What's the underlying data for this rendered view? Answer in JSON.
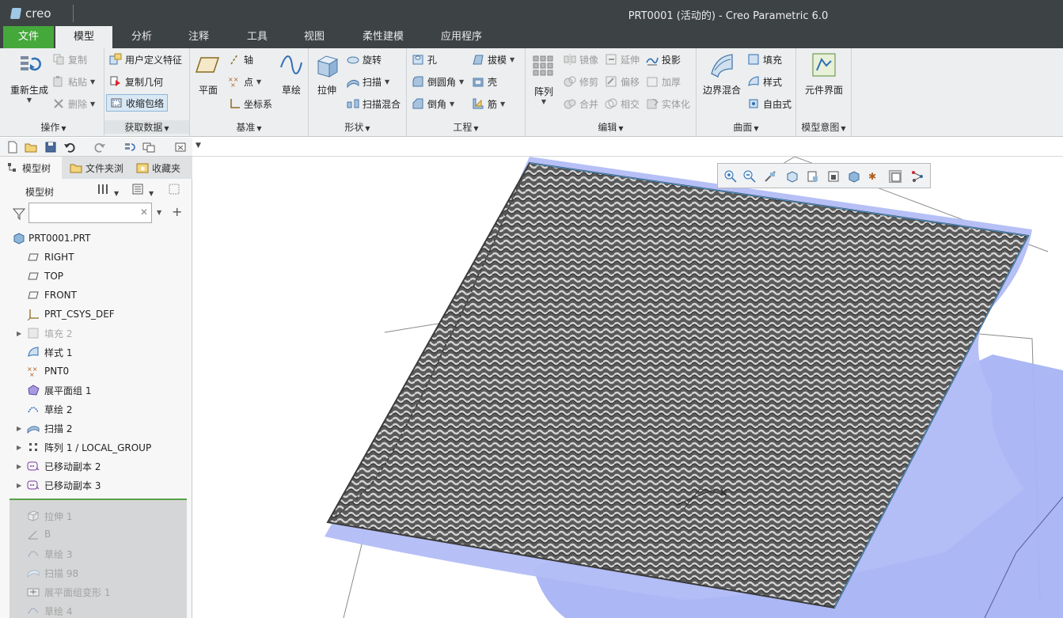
{
  "window": {
    "app_name": "creo",
    "title": "PRT0001 (活动的) - Creo Parametric 6.0"
  },
  "menu_tabs": [
    {
      "label": "文件",
      "kind": "file"
    },
    {
      "label": "模型",
      "kind": "active"
    },
    {
      "label": "分析"
    },
    {
      "label": "注释"
    },
    {
      "label": "工具"
    },
    {
      "label": "视图"
    },
    {
      "label": "柔性建模"
    },
    {
      "label": "应用程序"
    }
  ],
  "ribbon": {
    "operations": {
      "label": "操作",
      "regenerate": "重新生成",
      "copy": "复制",
      "paste": "粘贴",
      "delete": "删除"
    },
    "get_data": {
      "label": "获取数据",
      "udf": "用户定义特征",
      "copy_geom": "复制几何",
      "shrinkwrap": "收缩包络"
    },
    "datum": {
      "label": "基准",
      "plane": "平面",
      "axis": "轴",
      "point": "点",
      "csys": "坐标系",
      "sketch": "草绘"
    },
    "shapes": {
      "label": "形状",
      "extrude": "拉伸",
      "revolve": "旋转",
      "sweep": "扫描",
      "swept_blend": "扫描混合"
    },
    "engineering": {
      "label": "工程",
      "hole": "孔",
      "round": "倒圆角",
      "chamfer": "倒角",
      "draft": "拔模",
      "shell": "壳",
      "rib": "筋"
    },
    "editing": {
      "label": "编辑",
      "pattern": "阵列",
      "mirror": "镜像",
      "extend": "延伸",
      "project": "投影",
      "trim": "修剪",
      "offset": "偏移",
      "thicken": "加厚",
      "merge": "合并",
      "intersect": "相交",
      "solidify": "实体化"
    },
    "surfaces": {
      "label": "曲面",
      "boundary_blend": "边界混合",
      "fill": "填充",
      "style": "样式",
      "freestyle": "自由式"
    },
    "model_intent": {
      "label": "模型意图",
      "component_interface": "元件界面"
    }
  },
  "panel": {
    "tabs": [
      "模型树",
      "文件夹浏",
      "收藏夹"
    ],
    "title": "模型树",
    "search": {
      "placeholder": "",
      "value": ""
    },
    "tree": [
      {
        "label": "PRT0001.PRT",
        "icon": "part-icon",
        "root": true
      },
      {
        "label": "RIGHT",
        "icon": "datum-plane-icon"
      },
      {
        "label": "TOP",
        "icon": "datum-plane-icon"
      },
      {
        "label": "FRONT",
        "icon": "datum-plane-icon"
      },
      {
        "label": "PRT_CSYS_DEF",
        "icon": "csys-icon"
      },
      {
        "label": "填充 2",
        "icon": "fill-icon",
        "expandable": true,
        "dim": true
      },
      {
        "label": "样式 1",
        "icon": "style-icon"
      },
      {
        "label": "PNT0",
        "icon": "datum-point-icon"
      },
      {
        "label": "展平面组 1",
        "icon": "flatten-quilt-icon"
      },
      {
        "label": "草绘 2",
        "icon": "sketch-icon"
      },
      {
        "label": "扫描 2",
        "icon": "sweep-icon",
        "expandable": true
      },
      {
        "label": "阵列 1 / LOCAL_GROUP",
        "icon": "pattern-icon",
        "expandable": true
      },
      {
        "label": "已移动副本 2",
        "icon": "moved-copy-icon",
        "expandable": true
      },
      {
        "label": "已移动副本 3",
        "icon": "moved-copy-icon",
        "expandable": true
      }
    ],
    "suppressed": [
      {
        "label": "拉伸 1",
        "icon": "extrude-icon"
      },
      {
        "label": "B",
        "icon": "datum-axis-icon"
      },
      {
        "label": "草绘 3",
        "icon": "sketch-icon"
      },
      {
        "label": "扫描 98",
        "icon": "sweep-icon"
      },
      {
        "label": "展平面组变形 1",
        "icon": "flatten-warp-icon"
      },
      {
        "label": "草绘 4",
        "icon": "sketch-icon"
      }
    ]
  },
  "colors": {
    "accent_green": "#45a83b",
    "titlebar": "#3d4245",
    "ribbon": "#eceeef",
    "surface_blue": "#a7b4f4",
    "mesh_dark": "#4a4a4a"
  }
}
